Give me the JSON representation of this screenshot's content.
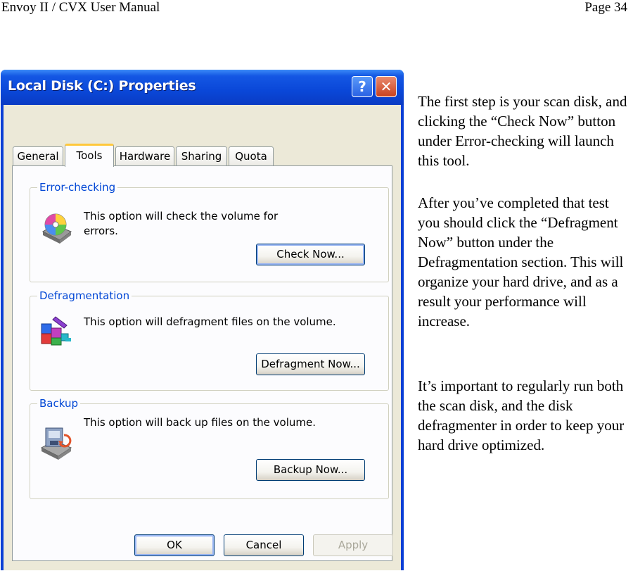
{
  "page_header": {
    "left": "Envoy II / CVX User Manual",
    "right": "Page 34"
  },
  "dialog": {
    "title": "Local Disk (C:) Properties",
    "help_glyph": "?",
    "close_glyph": "✕",
    "tabs": [
      "General",
      "Tools",
      "Hardware",
      "Sharing",
      "Quota"
    ],
    "active_tab": "Tools",
    "groups": {
      "error_checking": {
        "label": "Error-checking",
        "text_line1": "This option will check the volume for",
        "text_line2": "errors.",
        "button": "Check Now...",
        "icon": "scan-disk-icon"
      },
      "defragmentation": {
        "label": "Defragmentation",
        "text": "This option will defragment files on the volume.",
        "button": "Defragment Now...",
        "icon": "defragment-icon"
      },
      "backup": {
        "label": "Backup",
        "text": "This option will back up files on the volume.",
        "button": "Backup Now...",
        "icon": "backup-icon"
      }
    },
    "footer_buttons": {
      "ok": "OK",
      "cancel": "Cancel",
      "apply": "Apply"
    }
  },
  "description": {
    "para1": "The first step is your scan disk, and clicking the “Check Now” button under Error-checking will launch this tool.",
    "para2": "After you’ve completed that test you should click the “Defragment Now” button under the Defragmentation section.  This will organize your hard drive, and as a result your performance will increase.",
    "para3": "It’s important to regularly run both the scan disk, and the disk defragmenter in order to keep your hard drive optimized."
  }
}
